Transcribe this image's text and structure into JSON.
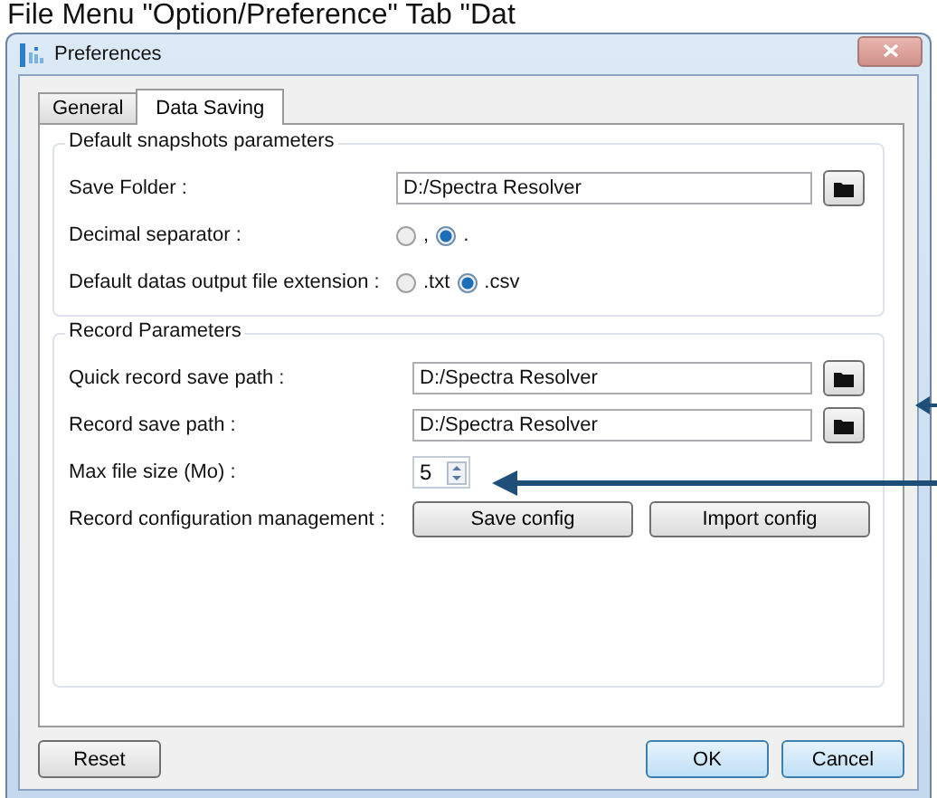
{
  "caption": "File Menu \"Option/Preference\" Tab \"Dat",
  "window": {
    "title": "Preferences"
  },
  "tabs": [
    {
      "label": "General",
      "selected": false
    },
    {
      "label": "Data Saving",
      "selected": true
    }
  ],
  "groups": [
    {
      "title": "Default snapshots parameters",
      "rows": [
        {
          "kind": "path",
          "label": "Save Folder :",
          "value": "D:/Spectra Resolver"
        },
        {
          "kind": "radio",
          "label": "Decimal separator :",
          "options": [
            {
              "label": ",",
              "selected": false
            },
            {
              "label": ".",
              "selected": true
            }
          ]
        },
        {
          "kind": "radio",
          "label": "Default datas output file extension :",
          "options": [
            {
              "label": ".txt",
              "selected": false
            },
            {
              "label": ".csv",
              "selected": true
            }
          ]
        }
      ]
    },
    {
      "title": "Record Parameters",
      "rows": [
        {
          "kind": "path",
          "label": "Quick record save path :",
          "value": "D:/Spectra Resolver"
        },
        {
          "kind": "path",
          "label": "Record save path :",
          "value": "D:/Spectra Resolver"
        },
        {
          "kind": "spinner",
          "label": "Max file size (Mo) :",
          "value": "5"
        },
        {
          "kind": "buttons",
          "label": "Record configuration management :",
          "buttons": [
            "Save config",
            "Import config"
          ]
        }
      ]
    }
  ],
  "buttons": [
    {
      "label": "Reset",
      "kind": "plain"
    },
    {
      "label": "OK",
      "kind": "default"
    },
    {
      "label": "Cancel",
      "kind": "default"
    }
  ]
}
